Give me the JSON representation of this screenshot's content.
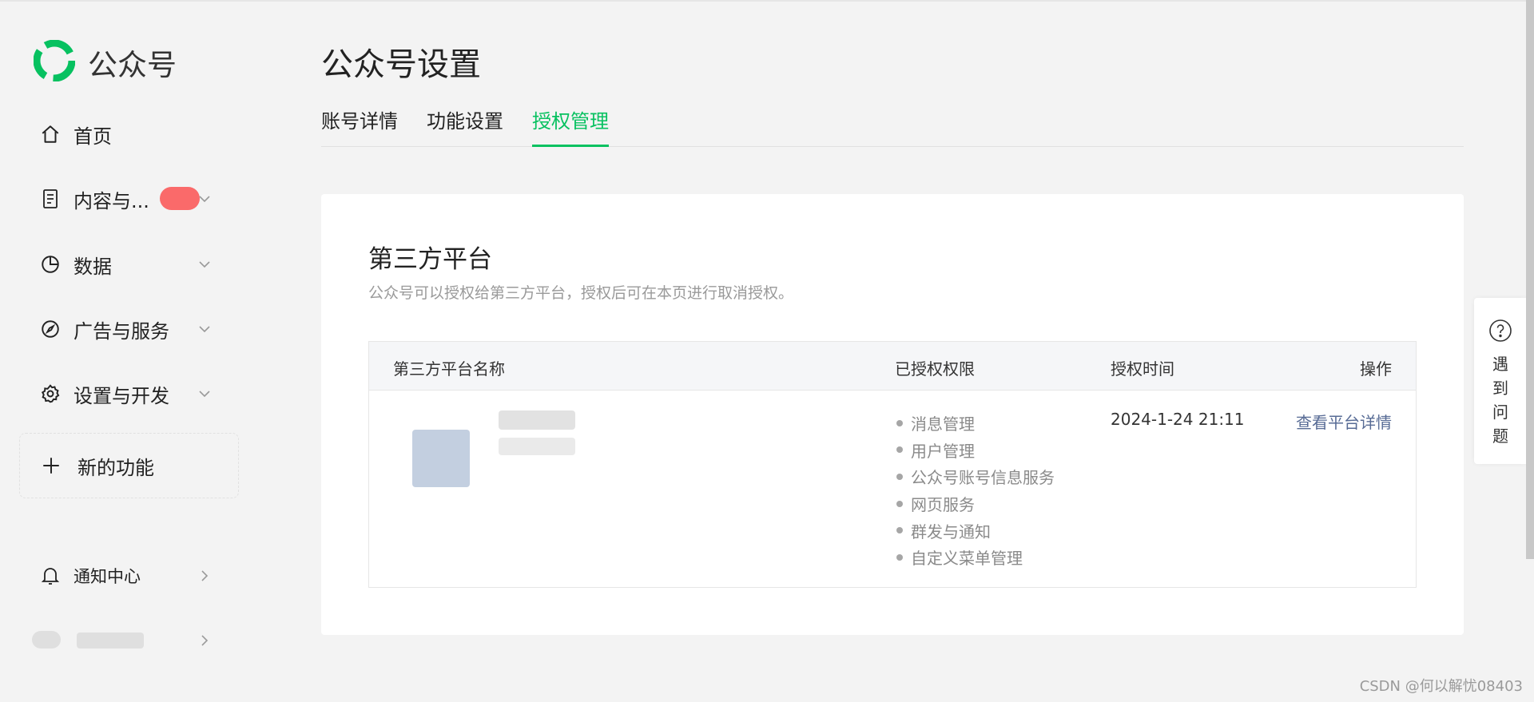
{
  "app": {
    "name": "公众号"
  },
  "sidebar": {
    "items": [
      {
        "label": "首页",
        "icon": "home-icon"
      },
      {
        "label": "内容与...",
        "icon": "document-icon"
      },
      {
        "label": "数据",
        "icon": "pie-chart-icon"
      },
      {
        "label": "广告与服务",
        "icon": "compass-icon"
      },
      {
        "label": "设置与开发",
        "icon": "gear-icon"
      }
    ],
    "new_feature": {
      "label": "新的功能",
      "icon": "plus-icon"
    },
    "notification": {
      "label": "通知中心",
      "icon": "bell-icon"
    }
  },
  "page": {
    "title": "公众号设置",
    "tabs": [
      {
        "label": "账号详情",
        "active": false
      },
      {
        "label": "功能设置",
        "active": false
      },
      {
        "label": "授权管理",
        "active": true
      }
    ]
  },
  "card": {
    "title": "第三方平台",
    "description": "公众号可以授权给第三方平台，授权后可在本页进行取消授权。",
    "table": {
      "headers": [
        "第三方平台名称",
        "已授权权限",
        "授权时间",
        "操作"
      ],
      "rows": [
        {
          "permissions": [
            "消息管理",
            "用户管理",
            "公众号账号信息服务",
            "网页服务",
            "群发与通知",
            "自定义菜单管理"
          ],
          "auth_time": "2024-1-24 21:11",
          "action": "查看平台详情"
        }
      ]
    }
  },
  "help": {
    "label": "遇到问题"
  },
  "watermark": "CSDN @何以解忧08403",
  "colors": {
    "accent": "#07c160",
    "link": "#576b95",
    "badge": "#fa5151"
  }
}
